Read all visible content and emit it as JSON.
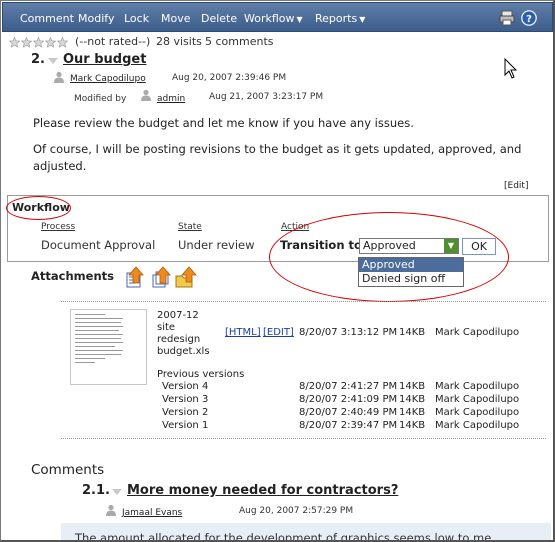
{
  "toolbar": {
    "items": [
      {
        "label": "Comment"
      },
      {
        "label": "Modify"
      },
      {
        "label": "Lock"
      },
      {
        "label": "Move"
      },
      {
        "label": "Delete"
      },
      {
        "label": "Workflow",
        "has_menu": true
      },
      {
        "label": "Reports",
        "has_menu": true
      }
    ],
    "icons": [
      "printer-icon",
      "help-icon"
    ],
    "bg_color": "#4a6a98"
  },
  "rating": {
    "stars": 5,
    "rated": 0,
    "status": "(--not rated--)",
    "visits": "28 visits",
    "comments": "5 comments"
  },
  "item": {
    "number": "2.",
    "title": "Our budget",
    "author": "Mark Capodilupo",
    "created": "Aug 20, 2007 2:39:46 PM",
    "modified_label": "Modified by",
    "modified_by": "admin",
    "modified": "Aug 21, 2007 3:23:17 PM",
    "body": [
      "Please review the budget and let me know if you have any issues.",
      "Of course, I will be posting revisions to the budget as it gets updated, approved, and adjusted."
    ],
    "edit_link": "[Edit]"
  },
  "workflow": {
    "heading": "Workflow",
    "process_label": "Process",
    "process_value": "Document Approval",
    "state_label": "State",
    "state_value": "Under review",
    "action_label": "Action",
    "transition_label": "Transition to:",
    "selected": "Approved",
    "options": [
      "Approved",
      "Denied sign off"
    ],
    "ok_label": "OK",
    "highlight_color": "#d40000"
  },
  "attachments": {
    "heading": "Attachments",
    "icons": [
      "upload-file-icon",
      "upload-new-version-icon",
      "upload-folder-icon"
    ],
    "file": {
      "name_lines": [
        "2007-12",
        "site",
        "redesign",
        "budget.xls"
      ],
      "html_link": "[HTML]",
      "edit_link": "[EDIT]",
      "date": "8/20/07 3:13:12 PM",
      "size": "14KB",
      "owner": "Mark Capodilupo"
    },
    "prev_heading": "Previous versions",
    "versions": [
      {
        "label": "Version 4",
        "date": "8/20/07 2:41:27 PM",
        "size": "14KB",
        "owner": "Mark Capodilupo"
      },
      {
        "label": "Version 3",
        "date": "8/20/07 2:41:09 PM",
        "size": "14KB",
        "owner": "Mark Capodilupo"
      },
      {
        "label": "Version 2",
        "date": "8/20/07 2:40:49 PM",
        "size": "14KB",
        "owner": "Mark Capodilupo"
      },
      {
        "label": "Version 1",
        "date": "8/20/07 2:39:47 PM",
        "size": "14KB",
        "owner": "Mark Capodilupo"
      }
    ]
  },
  "comments": {
    "heading": "Comments",
    "first": {
      "number": "2.1.",
      "title": "More money needed for contractors?",
      "author": "Jamaal Evans",
      "date": "Aug 20, 2007 2:57:29 PM",
      "snippet": "The amount allocated for the development of graphics seems low to me"
    }
  }
}
